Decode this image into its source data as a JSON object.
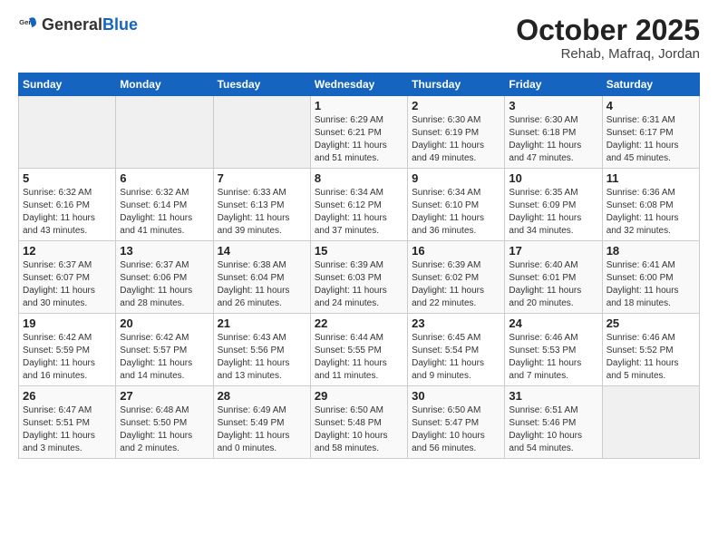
{
  "header": {
    "logo_general": "General",
    "logo_blue": "Blue",
    "title": "October 2025",
    "subtitle": "Rehab, Mafraq, Jordan"
  },
  "days_of_week": [
    "Sunday",
    "Monday",
    "Tuesday",
    "Wednesday",
    "Thursday",
    "Friday",
    "Saturday"
  ],
  "weeks": [
    [
      {
        "day": "",
        "sunrise": "",
        "sunset": "",
        "daylight": ""
      },
      {
        "day": "",
        "sunrise": "",
        "sunset": "",
        "daylight": ""
      },
      {
        "day": "",
        "sunrise": "",
        "sunset": "",
        "daylight": ""
      },
      {
        "day": "1",
        "sunrise": "Sunrise: 6:29 AM",
        "sunset": "Sunset: 6:21 PM",
        "daylight": "Daylight: 11 hours and 51 minutes."
      },
      {
        "day": "2",
        "sunrise": "Sunrise: 6:30 AM",
        "sunset": "Sunset: 6:19 PM",
        "daylight": "Daylight: 11 hours and 49 minutes."
      },
      {
        "day": "3",
        "sunrise": "Sunrise: 6:30 AM",
        "sunset": "Sunset: 6:18 PM",
        "daylight": "Daylight: 11 hours and 47 minutes."
      },
      {
        "day": "4",
        "sunrise": "Sunrise: 6:31 AM",
        "sunset": "Sunset: 6:17 PM",
        "daylight": "Daylight: 11 hours and 45 minutes."
      }
    ],
    [
      {
        "day": "5",
        "sunrise": "Sunrise: 6:32 AM",
        "sunset": "Sunset: 6:16 PM",
        "daylight": "Daylight: 11 hours and 43 minutes."
      },
      {
        "day": "6",
        "sunrise": "Sunrise: 6:32 AM",
        "sunset": "Sunset: 6:14 PM",
        "daylight": "Daylight: 11 hours and 41 minutes."
      },
      {
        "day": "7",
        "sunrise": "Sunrise: 6:33 AM",
        "sunset": "Sunset: 6:13 PM",
        "daylight": "Daylight: 11 hours and 39 minutes."
      },
      {
        "day": "8",
        "sunrise": "Sunrise: 6:34 AM",
        "sunset": "Sunset: 6:12 PM",
        "daylight": "Daylight: 11 hours and 37 minutes."
      },
      {
        "day": "9",
        "sunrise": "Sunrise: 6:34 AM",
        "sunset": "Sunset: 6:10 PM",
        "daylight": "Daylight: 11 hours and 36 minutes."
      },
      {
        "day": "10",
        "sunrise": "Sunrise: 6:35 AM",
        "sunset": "Sunset: 6:09 PM",
        "daylight": "Daylight: 11 hours and 34 minutes."
      },
      {
        "day": "11",
        "sunrise": "Sunrise: 6:36 AM",
        "sunset": "Sunset: 6:08 PM",
        "daylight": "Daylight: 11 hours and 32 minutes."
      }
    ],
    [
      {
        "day": "12",
        "sunrise": "Sunrise: 6:37 AM",
        "sunset": "Sunset: 6:07 PM",
        "daylight": "Daylight: 11 hours and 30 minutes."
      },
      {
        "day": "13",
        "sunrise": "Sunrise: 6:37 AM",
        "sunset": "Sunset: 6:06 PM",
        "daylight": "Daylight: 11 hours and 28 minutes."
      },
      {
        "day": "14",
        "sunrise": "Sunrise: 6:38 AM",
        "sunset": "Sunset: 6:04 PM",
        "daylight": "Daylight: 11 hours and 26 minutes."
      },
      {
        "day": "15",
        "sunrise": "Sunrise: 6:39 AM",
        "sunset": "Sunset: 6:03 PM",
        "daylight": "Daylight: 11 hours and 24 minutes."
      },
      {
        "day": "16",
        "sunrise": "Sunrise: 6:39 AM",
        "sunset": "Sunset: 6:02 PM",
        "daylight": "Daylight: 11 hours and 22 minutes."
      },
      {
        "day": "17",
        "sunrise": "Sunrise: 6:40 AM",
        "sunset": "Sunset: 6:01 PM",
        "daylight": "Daylight: 11 hours and 20 minutes."
      },
      {
        "day": "18",
        "sunrise": "Sunrise: 6:41 AM",
        "sunset": "Sunset: 6:00 PM",
        "daylight": "Daylight: 11 hours and 18 minutes."
      }
    ],
    [
      {
        "day": "19",
        "sunrise": "Sunrise: 6:42 AM",
        "sunset": "Sunset: 5:59 PM",
        "daylight": "Daylight: 11 hours and 16 minutes."
      },
      {
        "day": "20",
        "sunrise": "Sunrise: 6:42 AM",
        "sunset": "Sunset: 5:57 PM",
        "daylight": "Daylight: 11 hours and 14 minutes."
      },
      {
        "day": "21",
        "sunrise": "Sunrise: 6:43 AM",
        "sunset": "Sunset: 5:56 PM",
        "daylight": "Daylight: 11 hours and 13 minutes."
      },
      {
        "day": "22",
        "sunrise": "Sunrise: 6:44 AM",
        "sunset": "Sunset: 5:55 PM",
        "daylight": "Daylight: 11 hours and 11 minutes."
      },
      {
        "day": "23",
        "sunrise": "Sunrise: 6:45 AM",
        "sunset": "Sunset: 5:54 PM",
        "daylight": "Daylight: 11 hours and 9 minutes."
      },
      {
        "day": "24",
        "sunrise": "Sunrise: 6:46 AM",
        "sunset": "Sunset: 5:53 PM",
        "daylight": "Daylight: 11 hours and 7 minutes."
      },
      {
        "day": "25",
        "sunrise": "Sunrise: 6:46 AM",
        "sunset": "Sunset: 5:52 PM",
        "daylight": "Daylight: 11 hours and 5 minutes."
      }
    ],
    [
      {
        "day": "26",
        "sunrise": "Sunrise: 6:47 AM",
        "sunset": "Sunset: 5:51 PM",
        "daylight": "Daylight: 11 hours and 3 minutes."
      },
      {
        "day": "27",
        "sunrise": "Sunrise: 6:48 AM",
        "sunset": "Sunset: 5:50 PM",
        "daylight": "Daylight: 11 hours and 2 minutes."
      },
      {
        "day": "28",
        "sunrise": "Sunrise: 6:49 AM",
        "sunset": "Sunset: 5:49 PM",
        "daylight": "Daylight: 11 hours and 0 minutes."
      },
      {
        "day": "29",
        "sunrise": "Sunrise: 6:50 AM",
        "sunset": "Sunset: 5:48 PM",
        "daylight": "Daylight: 10 hours and 58 minutes."
      },
      {
        "day": "30",
        "sunrise": "Sunrise: 6:50 AM",
        "sunset": "Sunset: 5:47 PM",
        "daylight": "Daylight: 10 hours and 56 minutes."
      },
      {
        "day": "31",
        "sunrise": "Sunrise: 6:51 AM",
        "sunset": "Sunset: 5:46 PM",
        "daylight": "Daylight: 10 hours and 54 minutes."
      },
      {
        "day": "",
        "sunrise": "",
        "sunset": "",
        "daylight": ""
      }
    ]
  ]
}
